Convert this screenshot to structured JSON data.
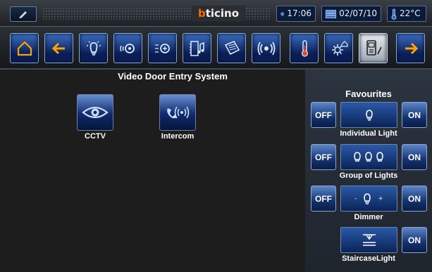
{
  "topbar": {
    "brand_prefix": "b",
    "brand_rest": "ticino",
    "time": "17:06",
    "date": "02/07/10",
    "temperature": "22°C",
    "edit_icon": "pencil-icon"
  },
  "toolbar": {
    "buttons": [
      {
        "name": "home-icon"
      },
      {
        "name": "back-arrow-icon"
      },
      {
        "name": "lighting-icon"
      },
      {
        "name": "automation-icon"
      },
      {
        "name": "scenario-icon"
      },
      {
        "name": "sound-system-icon"
      },
      {
        "name": "energy-icon"
      },
      {
        "name": "alarm-icon"
      },
      {
        "name": "temperature-icon"
      },
      {
        "name": "settings-icon"
      },
      {
        "name": "video-door-entry-icon"
      },
      {
        "name": "forward-arrow-icon"
      }
    ]
  },
  "main": {
    "title": "Video Door Entry System",
    "apps": [
      {
        "label": "CCTV",
        "icon": "eye-icon"
      },
      {
        "label": "Intercom",
        "icon": "intercom-icon"
      }
    ]
  },
  "favourites": {
    "title": "Favourites",
    "off_label": "OFF",
    "on_label": "ON",
    "items": [
      {
        "label": "Individual Light"
      },
      {
        "label": "Group of Lights"
      },
      {
        "label": "Dimmer",
        "minus": "-",
        "plus": "+"
      },
      {
        "label": "StaircaseLight"
      }
    ]
  },
  "colors": {
    "brand_accent": "#ff6a00",
    "button_blue": "#143370",
    "arrow_orange": "#ff9d00"
  }
}
